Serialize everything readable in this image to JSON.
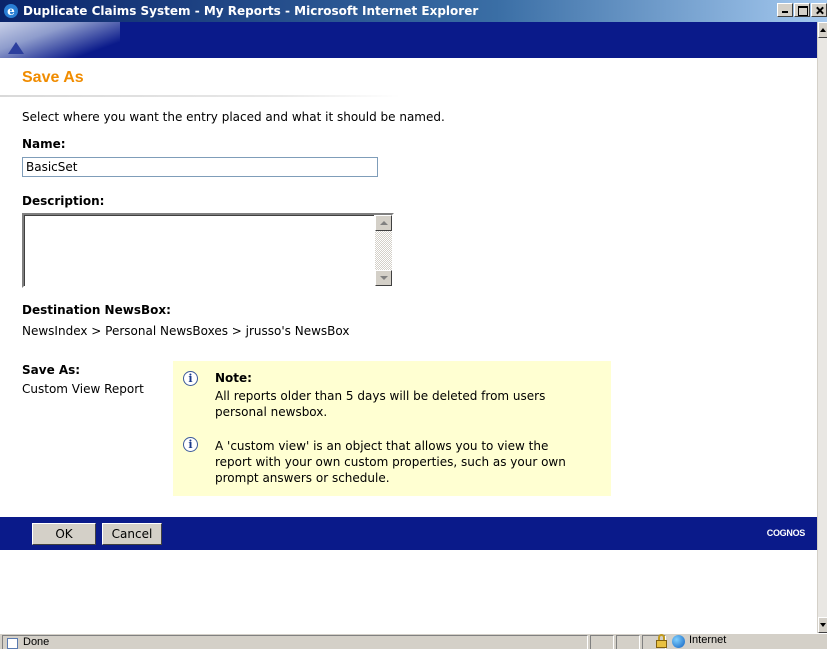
{
  "window": {
    "title": "Duplicate Claims System - My Reports - Microsoft Internet Explorer"
  },
  "page": {
    "title": "Save As",
    "intro": "Select where you want the entry placed and what it should be named.",
    "name_label": "Name:",
    "name_value": "BasicSet",
    "description_label": "Description:",
    "description_value": "",
    "destination_label": "Destination NewsBox:",
    "destination_path": "NewsIndex > Personal NewsBoxes > jrusso's NewsBox",
    "save_as_label": "Save As:",
    "save_as_value": "Custom View Report"
  },
  "note": {
    "title": "Note:",
    "line1": "All reports older than 5 days will be deleted from users",
    "line2": "personal newsbox.",
    "line3": "A 'custom view' is an object that allows you to view the",
    "line4": "report with your own custom properties, such as your own",
    "line5": "prompt answers or schedule."
  },
  "buttons": {
    "ok": "OK",
    "cancel": "Cancel"
  },
  "brand": {
    "logo_text": "COGNOS"
  },
  "statusbar": {
    "status": "Done",
    "zone": "Internet"
  },
  "icons": {
    "info": "info-icon",
    "lock": "lock-icon",
    "globe": "internet-zone-icon"
  }
}
